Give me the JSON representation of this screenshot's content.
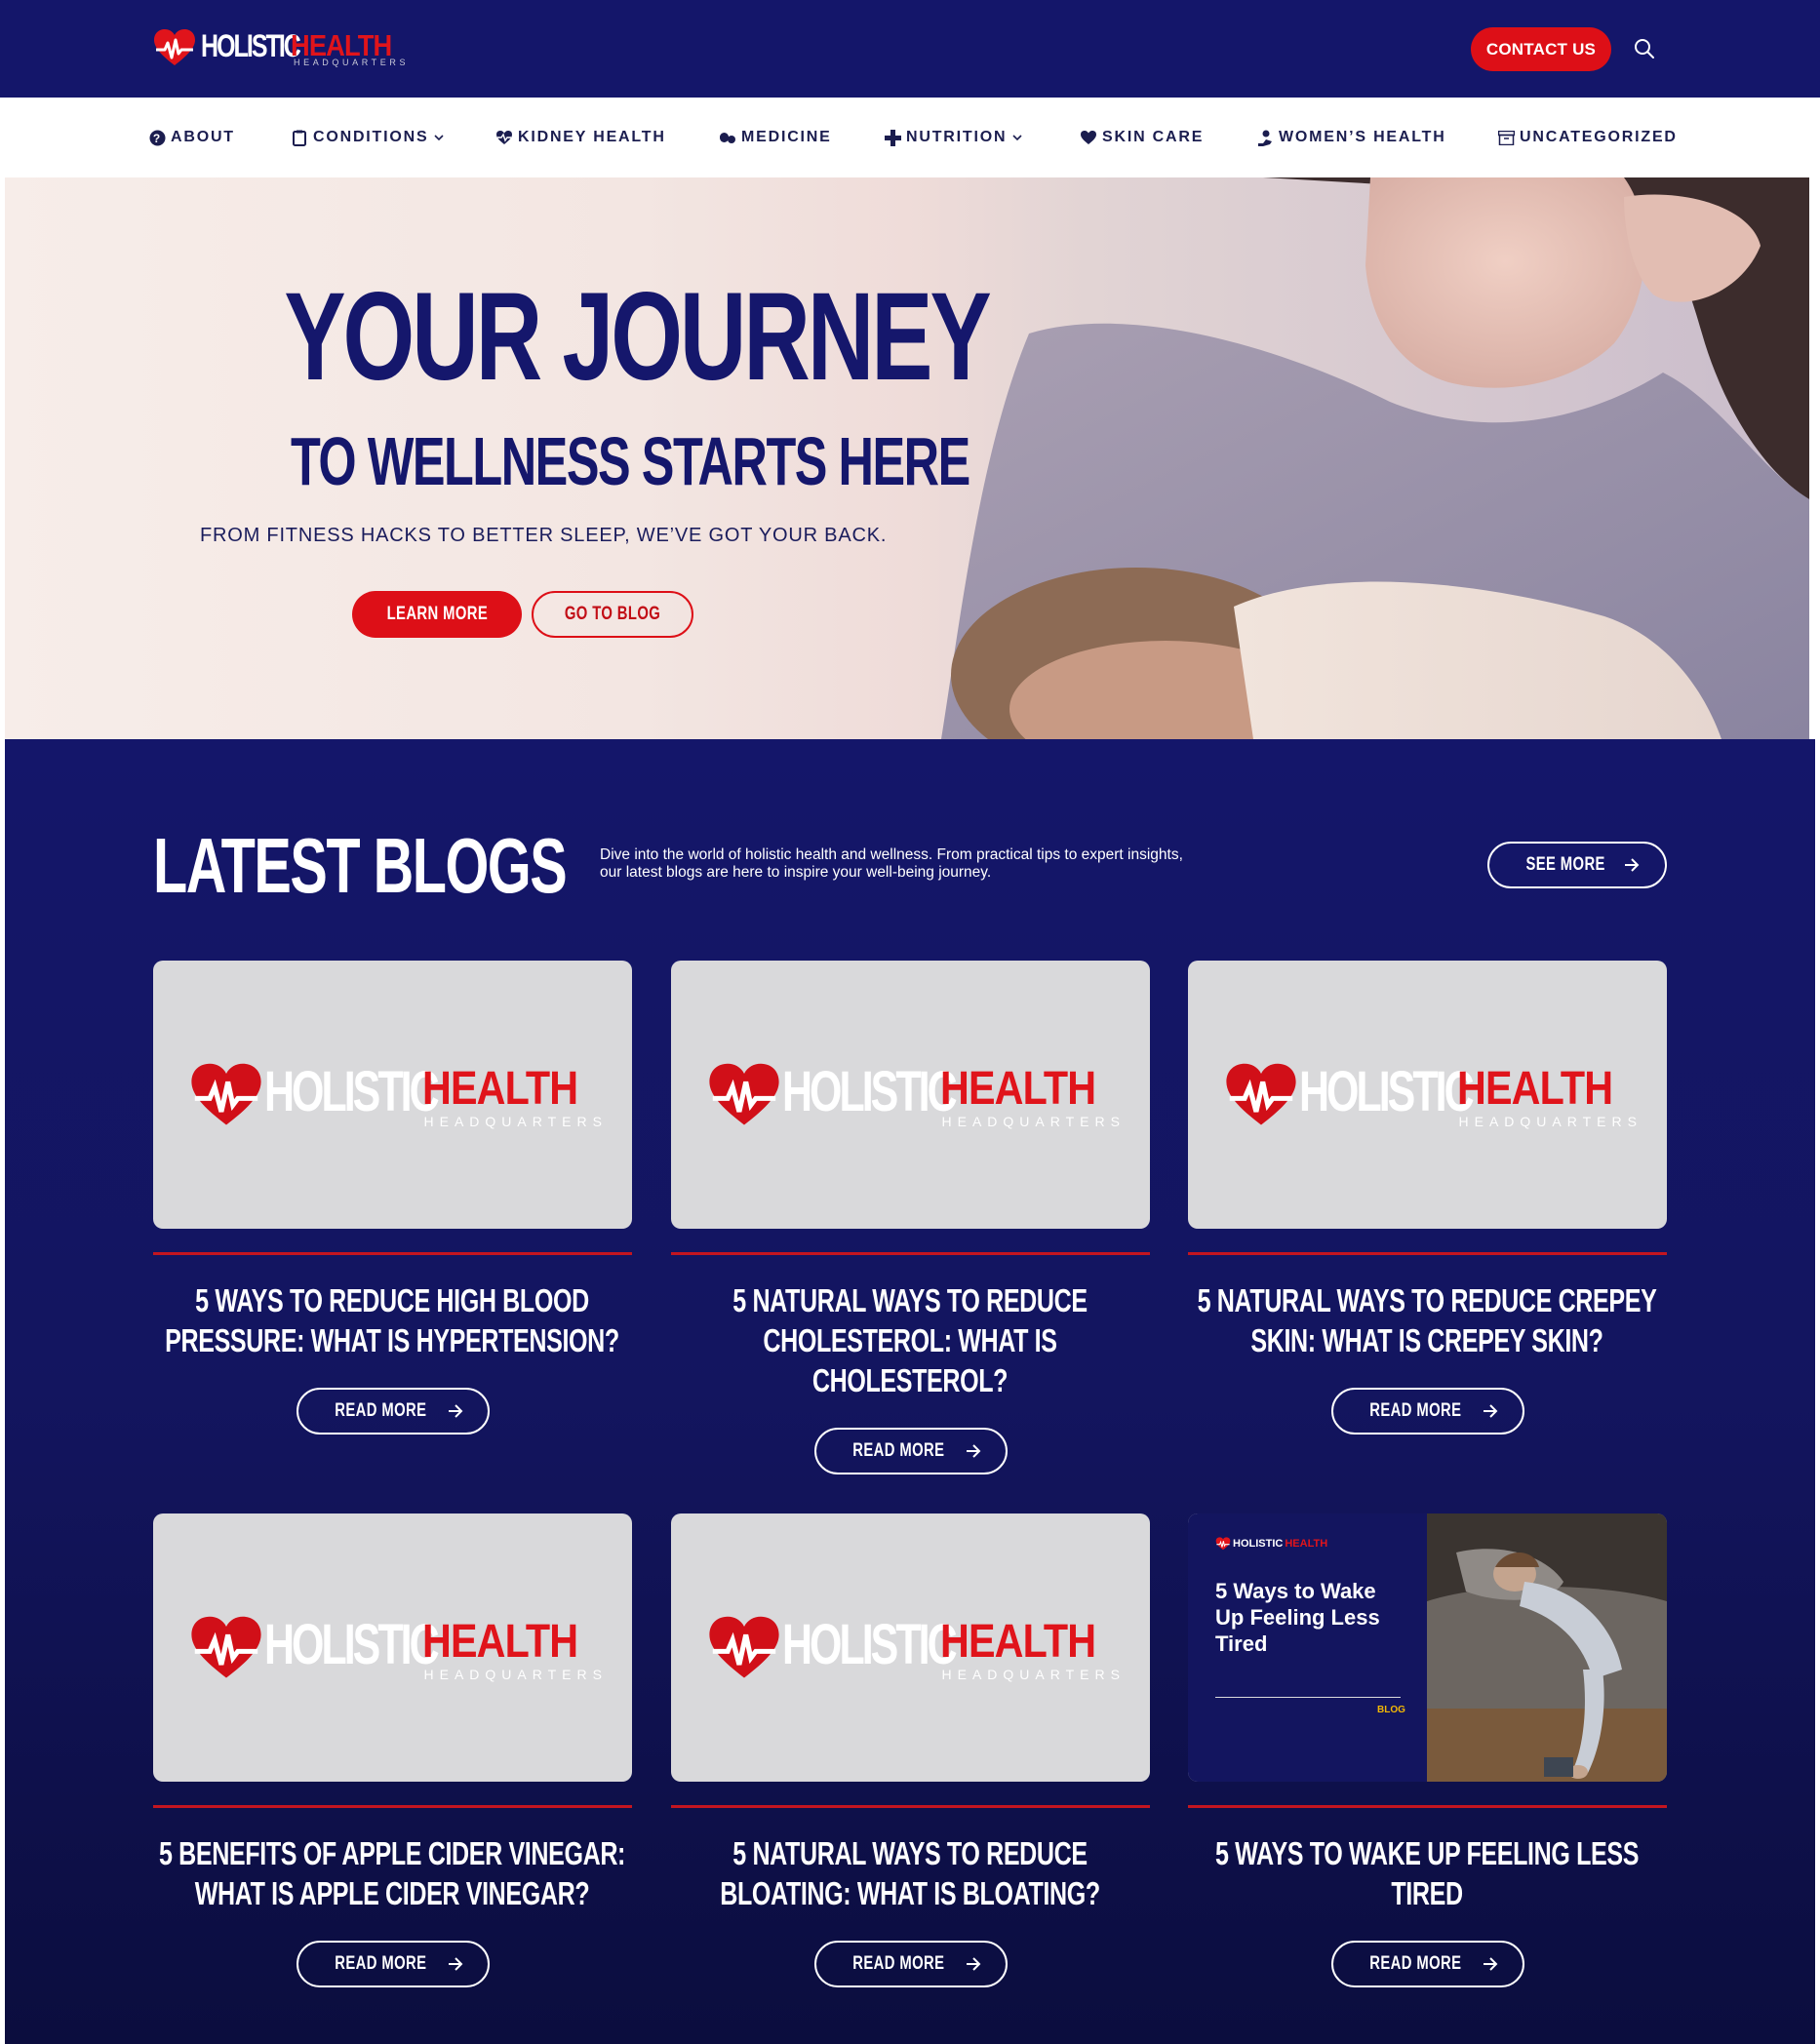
{
  "header": {
    "logo": {
      "word_a": "HOLISTIC",
      "word_b": "HEALTH",
      "word_c": "HEADQUARTERS"
    },
    "contact_label": "CONTACT US",
    "search_icon": "search-icon"
  },
  "nav": {
    "items": [
      {
        "label": "ABOUT",
        "icon": "question-circle-icon",
        "dropdown": false
      },
      {
        "label": "CONDITIONS",
        "icon": "clipboard-icon",
        "dropdown": true
      },
      {
        "label": "KIDNEY HEALTH",
        "icon": "heart-pulse-icon",
        "dropdown": false
      },
      {
        "label": "MEDICINE",
        "icon": "pills-icon",
        "dropdown": false
      },
      {
        "label": "NUTRITION",
        "icon": "plus-icon",
        "dropdown": true
      },
      {
        "label": "SKIN CARE",
        "icon": "heart-icon",
        "dropdown": false
      },
      {
        "label": "WOMEN’S HEALTH",
        "icon": "person-hand-icon",
        "dropdown": false
      },
      {
        "label": "UNCATEGORIZED",
        "icon": "archive-icon",
        "dropdown": false
      }
    ]
  },
  "hero": {
    "title": "YOUR JOURNEY",
    "subtitle": "TO WELLNESS STARTS HERE",
    "tagline": "FROM FITNESS HACKS TO BETTER SLEEP, WE’VE GOT YOUR BACK.",
    "learn_more": "LEARN MORE",
    "go_to_blog": "GO TO BLOG"
  },
  "blogs": {
    "title": "LATEST BLOGS",
    "description": "Dive into the world of holistic health and wellness. From practical tips to expert insights, our latest blogs are here to inspire your well-being journey.",
    "see_more": "SEE MORE",
    "read_more": "READ MORE",
    "posts": [
      {
        "title": "5 WAYS TO REDUCE HIGH BLOOD PRESSURE: WHAT IS HYPERTENSION?"
      },
      {
        "title": "5 NATURAL WAYS TO REDUCE CHOLESTEROL: WHAT IS CHOLESTEROL?"
      },
      {
        "title": "5 NATURAL WAYS TO REDUCE CREPEY SKIN: WHAT IS CREPEY SKIN?"
      },
      {
        "title": "5 BENEFITS OF APPLE CIDER VINEGAR: WHAT IS APPLE CIDER VINEGAR?"
      },
      {
        "title": "5 NATURAL WAYS TO REDUCE BLOATING: WHAT IS BLOATING?"
      },
      {
        "title": "5 WAYS TO WAKE UP FEELING LESS TIRED"
      }
    ],
    "promo": {
      "logo_a": "HOLISTIC",
      "logo_b": "HEALTH",
      "title": "5 Ways to Wake Up Feeling Less Tired",
      "tag": "BLOG"
    }
  },
  "colors": {
    "navy": "#14166a",
    "red": "#dd0f17",
    "white": "#ffffff",
    "placeholder_gray": "#d9d9db"
  }
}
